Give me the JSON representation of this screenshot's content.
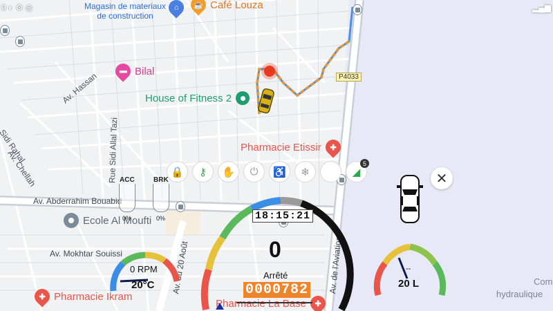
{
  "map": {
    "pois": {
      "materials": "Magasin de materiaux\nde construction",
      "cafe": "Café Louza",
      "bilal": "Bilal",
      "fitness": "House of Fitness 2",
      "etissir": "Pharmacie Etissir",
      "ecole": "Ecole Al Moufti",
      "ikram": "Pharmacie Ikram",
      "la_base": "Pharmacie La Base",
      "com": "Com",
      "hydraulique": "hydraulique"
    },
    "roads": {
      "hassan": "Av. Hassan",
      "sidi_rahal": "Sidi Rahal",
      "chellah": "Av. Chellah",
      "allal_tazi": "Rue Sidi Allal Tazi",
      "bouabid": "Av. Abderrahim Bouabid",
      "souissi": "Av. Mokhtar Souissi",
      "aout": "Av. du 20 Août",
      "aviation": "Av. de l'Aviation",
      "p4033": "P4033"
    }
  },
  "controls": {
    "buttons": [
      {
        "name": "lock",
        "icon": "lock-icon",
        "color": "#9a9a9a"
      },
      {
        "name": "key",
        "icon": "key-icon",
        "color": "#2aa84a"
      },
      {
        "name": "hand",
        "icon": "hand-icon",
        "color": "#9a9a9a"
      },
      {
        "name": "power",
        "icon": "power-icon",
        "color": "#9a9a9a"
      },
      {
        "name": "seat",
        "icon": "seat-icon",
        "color": "#9a9a9a"
      },
      {
        "name": "snow",
        "icon": "snowflake-icon",
        "color": "#9a9a9a"
      },
      {
        "name": "blank",
        "icon": "",
        "color": "#9a9a9a"
      },
      {
        "name": "signal",
        "icon": "signal-icon",
        "color": "#2aa84a"
      }
    ],
    "signal_badge": "5",
    "close_icon": "close-icon"
  },
  "pedals": {
    "acc": {
      "label": "ACC",
      "value": "0%",
      "level": 0
    },
    "brk": {
      "label": "BRK",
      "value": "0%",
      "level": 0
    }
  },
  "gauges": {
    "rpm": {
      "value": "0 RPM",
      "temp": "20°C"
    },
    "speed": {
      "value": "0",
      "status": "Arrêté",
      "clock": "18:15:21",
      "odometer": "0000782"
    },
    "fuel": {
      "value": "20 L"
    }
  },
  "colors": {
    "route": "#f39c2a",
    "route_blue": "#4a90e2",
    "marker": "#e8391e",
    "poi_red": "#e9554a",
    "poi_green": "#1e9e6e",
    "poi_pink": "#e64aa0",
    "poi_orange": "#f39c2a",
    "gauge_green": "#5cb85c",
    "gauge_blue": "#3a8ee6",
    "gauge_black": "#111111"
  }
}
